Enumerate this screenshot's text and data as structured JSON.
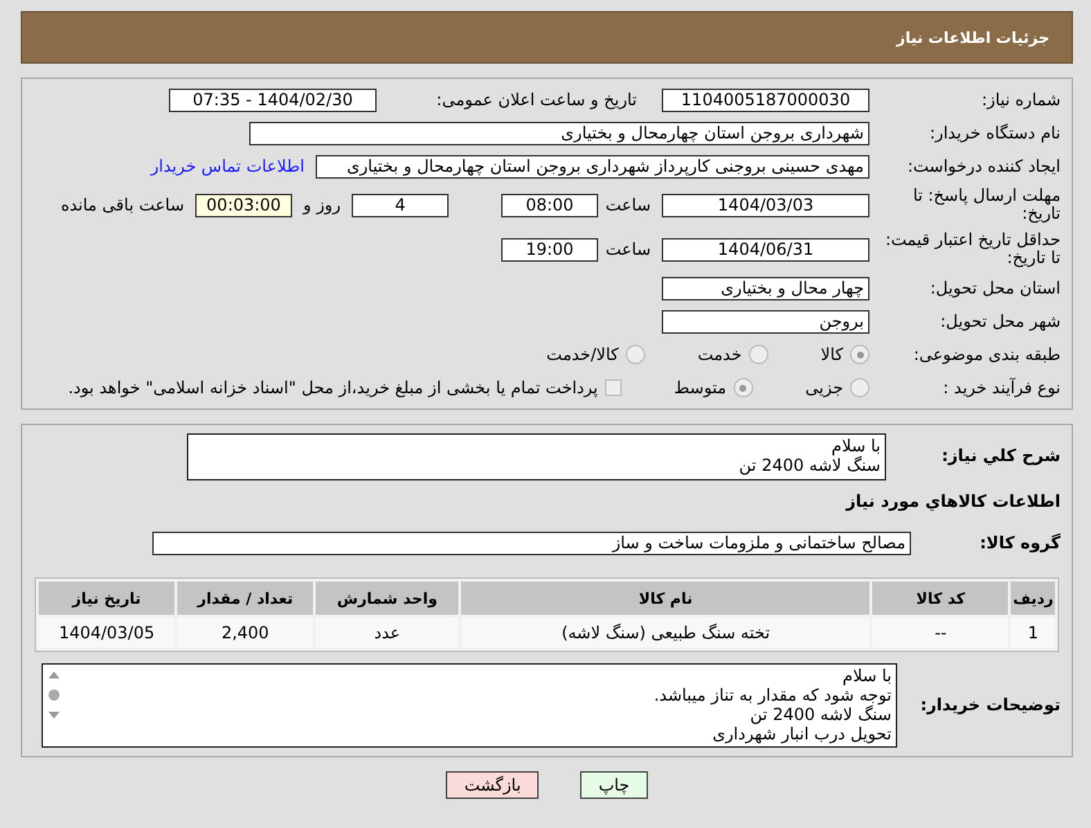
{
  "header": {
    "title": "جزئیات اطلاعات نیاز"
  },
  "need_number": {
    "label": "شماره نیاز:",
    "value": "1104005187000030"
  },
  "announce": {
    "label": "تاریخ و ساعت اعلان عمومی:",
    "value": "1404/02/30 - 07:35"
  },
  "buyer": {
    "label": "نام دستگاه خریدار:",
    "value": "شهرداری بروجن استان چهارمحال و بختیاری"
  },
  "creator": {
    "label": "ایجاد کننده درخواست:",
    "value": "مهدی حسینی بروجنی کارپرداز شهرداری بروجن استان چهارمحال و بختیاری",
    "link": "اطلاعات تماس خریدار"
  },
  "deadline": {
    "label": "مهلت ارسال پاسخ: تا تاریخ:",
    "date": "1404/03/03",
    "time_label": "ساعت",
    "time": "08:00",
    "days": "4",
    "days_label": "روز و",
    "remaining": "00:03:00",
    "remaining_label": "ساعت باقی مانده"
  },
  "validity": {
    "label": "حداقل تاریخ اعتبار قیمت: تا تاریخ:",
    "date": "1404/06/31",
    "time_label": "ساعت",
    "time": "19:00"
  },
  "province": {
    "label": "استان محل تحویل:",
    "value": "چهار محال و بختیاری"
  },
  "city": {
    "label": "شهر محل تحویل:",
    "value": "بروجن"
  },
  "category": {
    "label": "طبقه بندی موضوعی:",
    "options": [
      {
        "label": "کالا",
        "selected": true
      },
      {
        "label": "خدمت",
        "selected": false
      },
      {
        "label": "کالا/خدمت",
        "selected": false
      }
    ]
  },
  "process": {
    "label": "نوع فرآیند خرید :",
    "options": [
      {
        "label": "جزیی",
        "selected": false
      },
      {
        "label": "متوسط",
        "selected": true
      }
    ],
    "payment": {
      "label": "پرداخت تمام یا بخشی از مبلغ خرید،از محل \"اسناد خزانه اسلامی\" خواهد بود.",
      "checked": false
    }
  },
  "description": {
    "label": "شرح کلي نیاز:",
    "lines": [
      "با سلام",
      "سنگ لاشه 2400 تن"
    ]
  },
  "goods_heading": "اطلاعات کالاهاي مورد نیاز",
  "goods_group": {
    "label": "گروه کالا:",
    "value": "مصالح ساختمانی و ملزومات ساخت و ساز"
  },
  "table": {
    "columns": [
      "ردیف",
      "کد کالا",
      "نام کالا",
      "واحد شمارش",
      "تعداد / مقدار",
      "تاریخ نیاز"
    ],
    "rows": [
      [
        "1",
        "--",
        "تخته سنگ طبیعی (سنگ لاشه)",
        "عدد",
        "2,400",
        "1404/03/05"
      ]
    ]
  },
  "buyer_notes": {
    "label": "توضیحات خریدار:",
    "lines": [
      "با سلام",
      "توجه شود که مقدار به تناز میباشد.",
      "سنگ لاشه 2400 تن",
      "تحویل درب انبار شهرداری"
    ]
  },
  "buttons": [
    {
      "label": "چاپ",
      "kind": "print"
    },
    {
      "label": "بازگشت",
      "kind": "back"
    }
  ]
}
